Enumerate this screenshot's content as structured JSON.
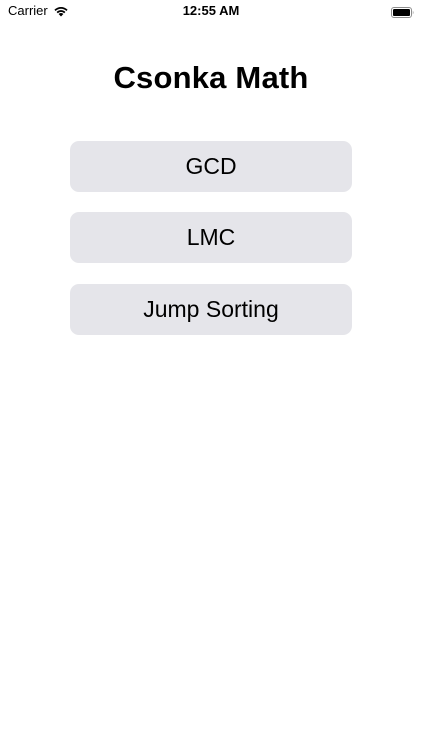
{
  "status_bar": {
    "carrier": "Carrier",
    "time": "12:55 AM",
    "wifi_icon": "wifi-icon",
    "battery_icon": "battery-icon"
  },
  "screen": {
    "title": "Csonka Math",
    "buttons": [
      {
        "label": "GCD"
      },
      {
        "label": "LMC"
      },
      {
        "label": "Jump Sorting"
      }
    ]
  },
  "colors": {
    "background": "#ffffff",
    "button_background": "#e5e5ea",
    "text": "#000000"
  }
}
